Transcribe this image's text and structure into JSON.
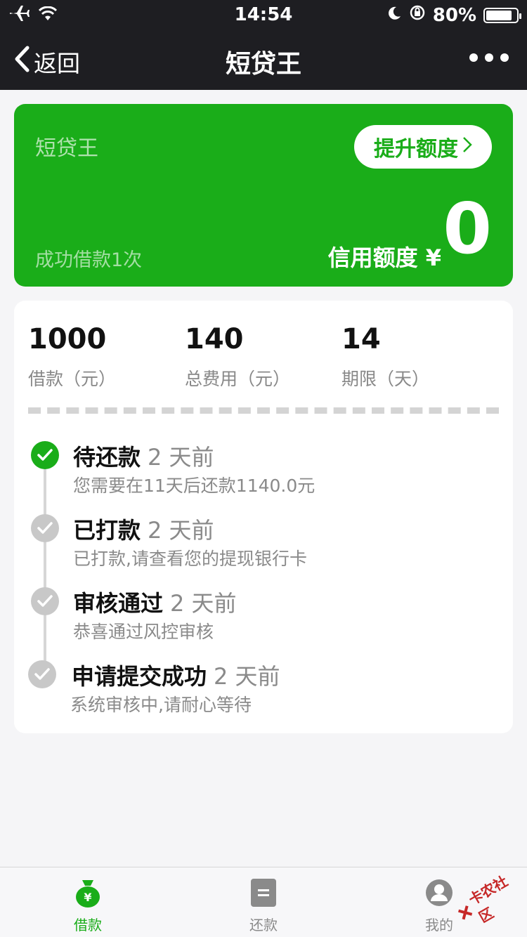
{
  "status_bar": {
    "time": "14:54",
    "battery": "80%"
  },
  "nav": {
    "back_label": "返回",
    "title": "短贷王"
  },
  "card": {
    "brand": "短贷王",
    "raise_button": "提升额度",
    "success_text": "成功借款1次",
    "credit_label": "信用额度 ¥",
    "credit_value": "0"
  },
  "stats": [
    {
      "value": "1000",
      "label": "借款（元）"
    },
    {
      "value": "140",
      "label": "总费用（元）"
    },
    {
      "value": "14",
      "label": "期限（天）"
    }
  ],
  "timeline": [
    {
      "title": "待还款",
      "ago": "2 天前",
      "desc": "您需要在11天后还款1140.0元",
      "active": true
    },
    {
      "title": "已打款",
      "ago": "2 天前",
      "desc": "已打款,请查看您的提现银行卡",
      "active": false
    },
    {
      "title": "审核通过",
      "ago": "2 天前",
      "desc": "恭喜通过风控审核",
      "active": false
    },
    {
      "title": "申请提交成功",
      "ago": "2 天前",
      "desc": "系统审核中,请耐心等待",
      "active": false
    }
  ],
  "tabs": [
    {
      "label": "借款",
      "icon": "money-bag-icon",
      "active": true
    },
    {
      "label": "还款",
      "icon": "document-icon",
      "active": false
    },
    {
      "label": "我的",
      "icon": "user-avatar-icon",
      "active": false
    }
  ],
  "watermark": "卡农社区",
  "colors": {
    "accent": "#1aad19",
    "topbar": "#1e1e22",
    "inactive": "#c8c8c8"
  }
}
